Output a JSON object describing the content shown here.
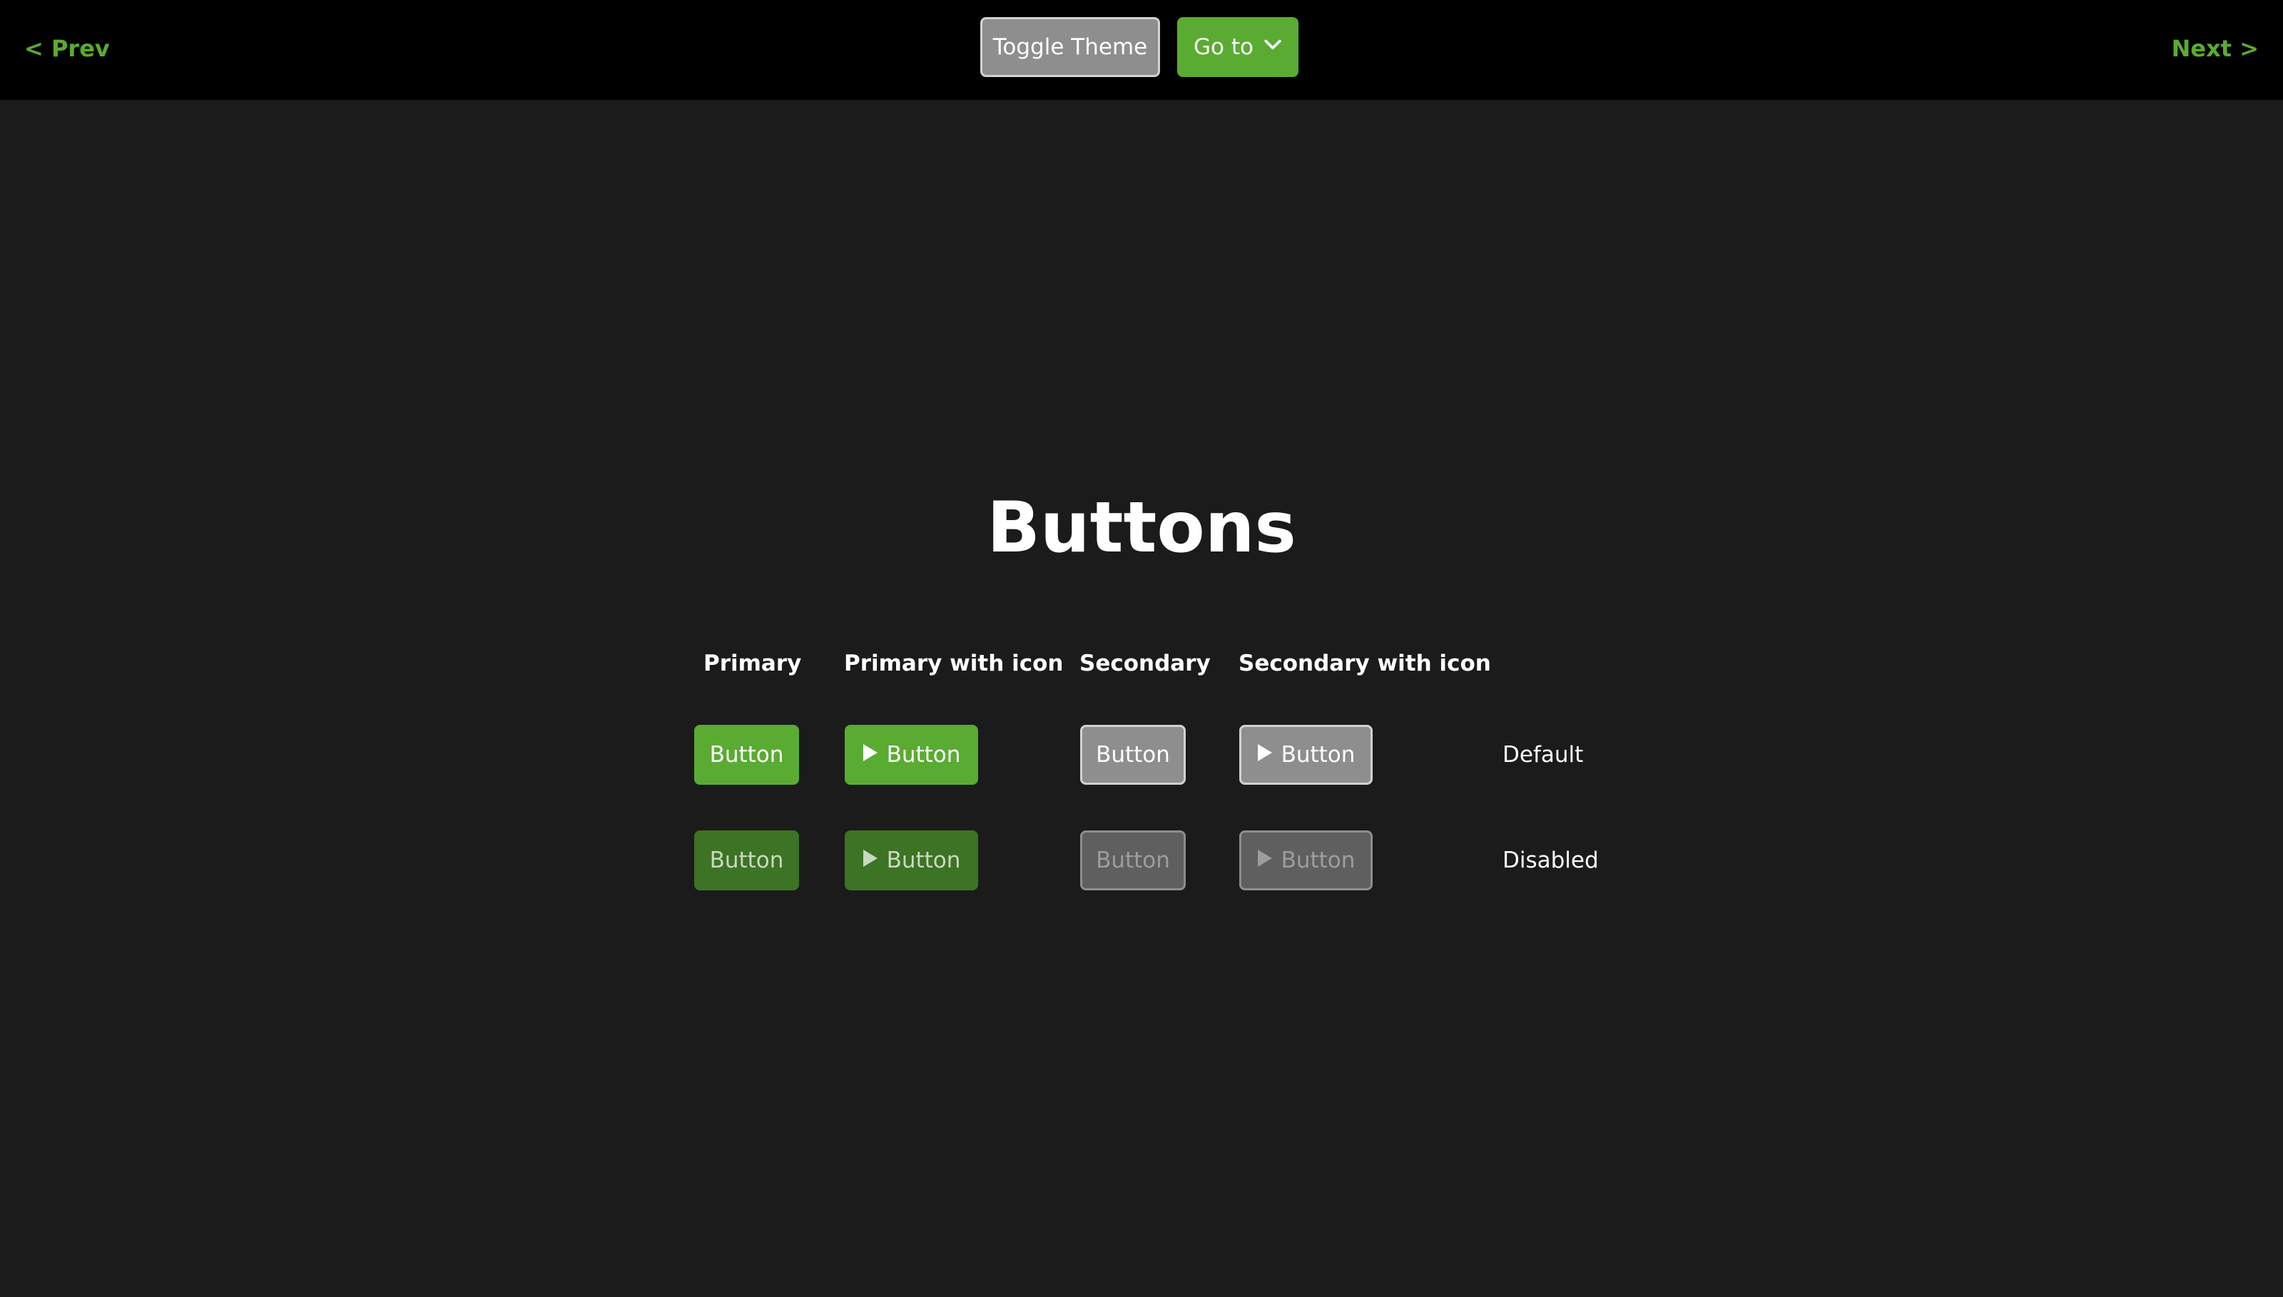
{
  "nav": {
    "prev_label": "< Prev",
    "next_label": "Next >",
    "toggle_theme_label": "Toggle Theme",
    "goto_label": "Go to",
    "goto_icon": "chevron-down-icon"
  },
  "page": {
    "title": "Buttons"
  },
  "table": {
    "columns": [
      "Primary",
      "Primary with icon",
      "Secondary",
      "Secondary with icon"
    ],
    "rows": [
      {
        "state": "Default",
        "buttons": [
          "Button",
          "Button",
          "Button",
          "Button"
        ]
      },
      {
        "state": "Disabled",
        "buttons": [
          "Button",
          "Button",
          "Button",
          "Button"
        ]
      }
    ],
    "button_icon": "play-icon"
  },
  "colors": {
    "background": "#1b1b1b",
    "topbar": "#000000",
    "accent": "#5aab32",
    "accent_disabled": "#3d7324",
    "secondary": "#8e8e8e",
    "secondary_disabled": "#5f5f5f"
  }
}
